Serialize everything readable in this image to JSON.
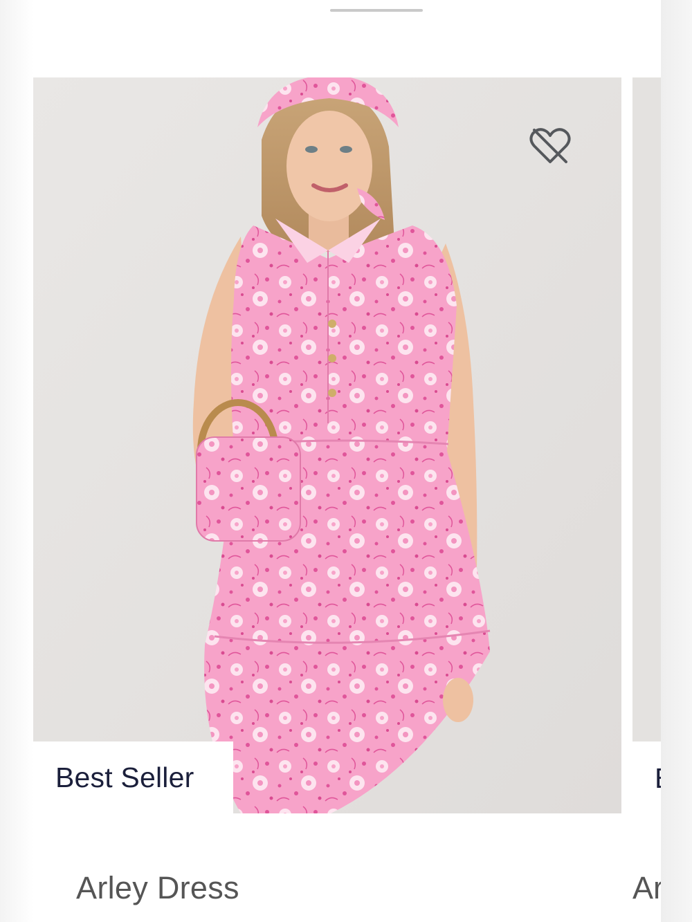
{
  "product_card": {
    "image_alt": "Model wearing a pink floral sleeveless tiered shirt dress with matching head scarf and bamboo-handle clutch",
    "wishlist_icon": "heart-off-icon",
    "badge": "Best Seller",
    "name": "Arley Dress"
  },
  "next_card": {
    "badge": "B",
    "name": "Ar"
  },
  "colors": {
    "badge_text": "#1b1f3b",
    "name_text": "#555555",
    "dress_pink": "#f59bc4",
    "print_magenta": "#e0559a"
  }
}
